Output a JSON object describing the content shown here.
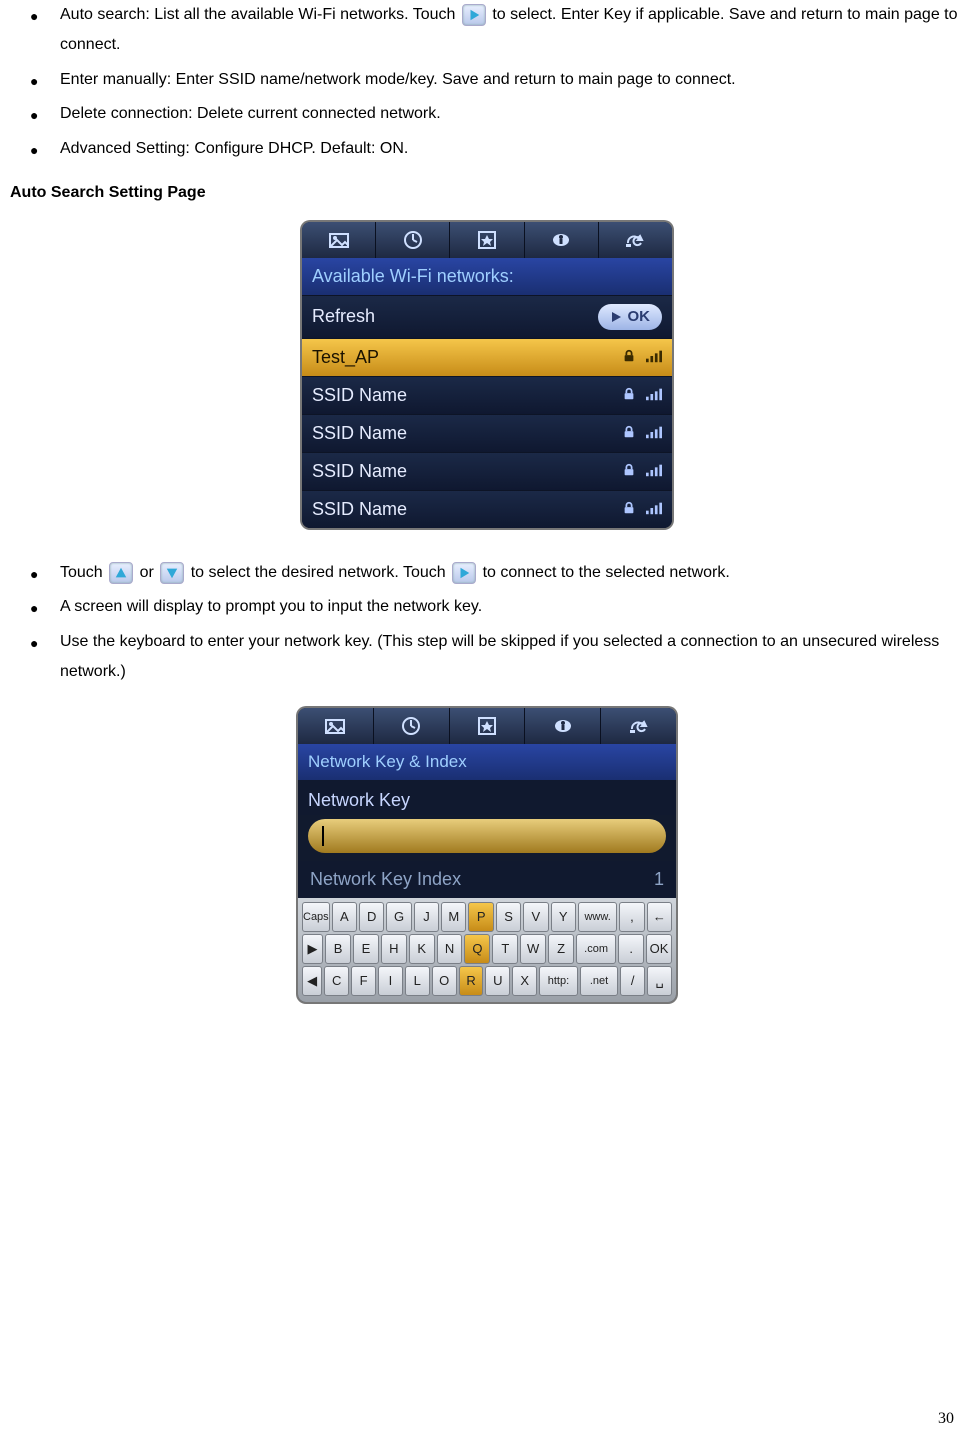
{
  "bullets_top": [
    {
      "parts": [
        {
          "t": "text",
          "v": "Auto search: List all the available Wi-Fi networks. Touch"
        },
        {
          "t": "icon",
          "v": "play-icon"
        },
        {
          "t": "text",
          "v": " to select. Enter Key if applicable. Save and return to main page to connect."
        }
      ]
    },
    {
      "parts": [
        {
          "t": "text",
          "v": "Enter manually: Enter SSID name/network mode/key. Save and return to main page to connect."
        }
      ]
    },
    {
      "parts": [
        {
          "t": "text",
          "v": "Delete connection: Delete current connected network."
        }
      ]
    },
    {
      "parts": [
        {
          "t": "text",
          "v": "Advanced Setting: Configure DHCP. Default: ON."
        }
      ]
    }
  ],
  "heading1": "Auto Search Setting Page",
  "device1": {
    "title": "Available Wi-Fi networks:",
    "refresh_label": "Refresh",
    "ok_label": "OK",
    "networks": [
      {
        "name": "Test_AP",
        "selected": true,
        "lock": true,
        "signal": true
      },
      {
        "name": "SSID Name",
        "selected": false,
        "lock": true,
        "signal": true
      },
      {
        "name": "SSID Name",
        "selected": false,
        "lock": true,
        "signal": true
      },
      {
        "name": "SSID Name",
        "selected": false,
        "lock": true,
        "signal": true
      },
      {
        "name": "SSID Name",
        "selected": false,
        "lock": true,
        "signal": true
      }
    ]
  },
  "bullets_mid": [
    {
      "parts": [
        {
          "t": "text",
          "v": "Touch"
        },
        {
          "t": "icon",
          "v": "triangle-up-icon"
        },
        {
          "t": "text",
          "v": " or"
        },
        {
          "t": "icon",
          "v": "triangle-down-icon"
        },
        {
          "t": "text",
          "v": " to select the desired network. Touch"
        },
        {
          "t": "icon",
          "v": "play-icon"
        },
        {
          "t": "text",
          "v": " to connect to the selected network."
        }
      ]
    },
    {
      "parts": [
        {
          "t": "text",
          "v": "A screen will display to prompt you to input the network key."
        }
      ]
    },
    {
      "parts": [
        {
          "t": "text",
          "v": "Use the keyboard to enter your network key. (This step will be skipped if you selected a connection to an unsecured wireless network.)"
        }
      ]
    }
  ],
  "device2": {
    "subtitle": "Network Key & Index",
    "field_label": "Network Key",
    "input_value": "",
    "index_label": "Network Key Index",
    "index_value": "1",
    "keyboard": [
      [
        "Caps",
        "A",
        "D",
        "G",
        "J",
        "M",
        "P",
        "S",
        "V",
        "Y",
        "www.",
        ",",
        "←"
      ],
      [
        "▶",
        "B",
        "E",
        "H",
        "K",
        "N",
        "Q",
        "T",
        "W",
        "Z",
        ".com",
        ".",
        "OK"
      ],
      [
        "◀",
        "C",
        "F",
        "I",
        "L",
        "O",
        "R",
        "U",
        "X",
        "http:",
        ".net",
        "/",
        "␣"
      ]
    ],
    "highlighted_keys": [
      "P",
      "Q",
      "R"
    ]
  },
  "page_number": "30"
}
